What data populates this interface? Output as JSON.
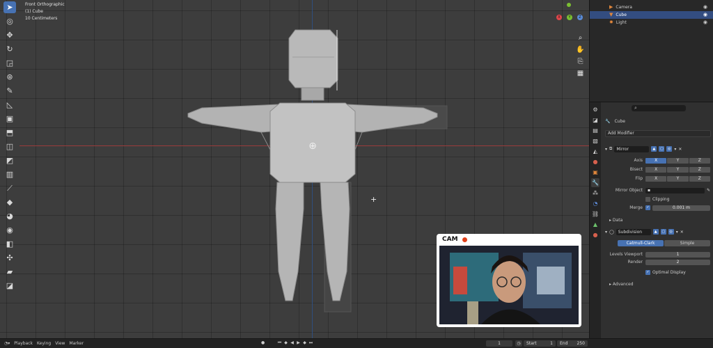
{
  "viewport": {
    "view_name": "Front Orthographic",
    "object_label": "(1) Cube",
    "scale_label": "10 Centimeters"
  },
  "gizmo": {
    "x": "X",
    "y": "Y",
    "z": "Z"
  },
  "webcam": {
    "label": "CAM",
    "accent": "#e0401a"
  },
  "outliner": {
    "items": [
      {
        "name": "Camera",
        "icon": "camera-icon"
      },
      {
        "name": "Cube",
        "icon": "mesh-icon",
        "selected": true
      },
      {
        "name": "Light",
        "icon": "light-icon"
      }
    ]
  },
  "properties": {
    "object_name": "Cube",
    "add_modifier": "Add Modifier",
    "mirror": {
      "name": "Mirror",
      "axis_label": "Axis",
      "bisect_label": "Bisect",
      "flip_label": "Flip",
      "x": "X",
      "y": "Y",
      "z": "Z",
      "mirror_object_label": "Mirror Object",
      "clipping_label": "Clipping",
      "merge_label": "Merge",
      "merge_value": "0.001 m",
      "data_label": "Data"
    },
    "subdivision": {
      "name": "Subdivision",
      "catmull_label": "Catmull-Clark",
      "simple_label": "Simple",
      "levels_viewport_label": "Levels Viewport",
      "levels_viewport_value": "1",
      "render_label": "Render",
      "render_value": "2",
      "optimal_display_label": "Optimal Display",
      "advanced_label": "Advanced"
    }
  },
  "timeline": {
    "playback": "Playback",
    "keying": "Keying",
    "view": "View",
    "marker": "Marker",
    "current_frame": "1",
    "start_label": "Start",
    "start_value": "1",
    "end_label": "End",
    "end_value": "250"
  },
  "colors": {
    "accent_blue": "#4772b3",
    "x_axis": "#9b3c3c",
    "z_axis": "#2f4f7f"
  }
}
